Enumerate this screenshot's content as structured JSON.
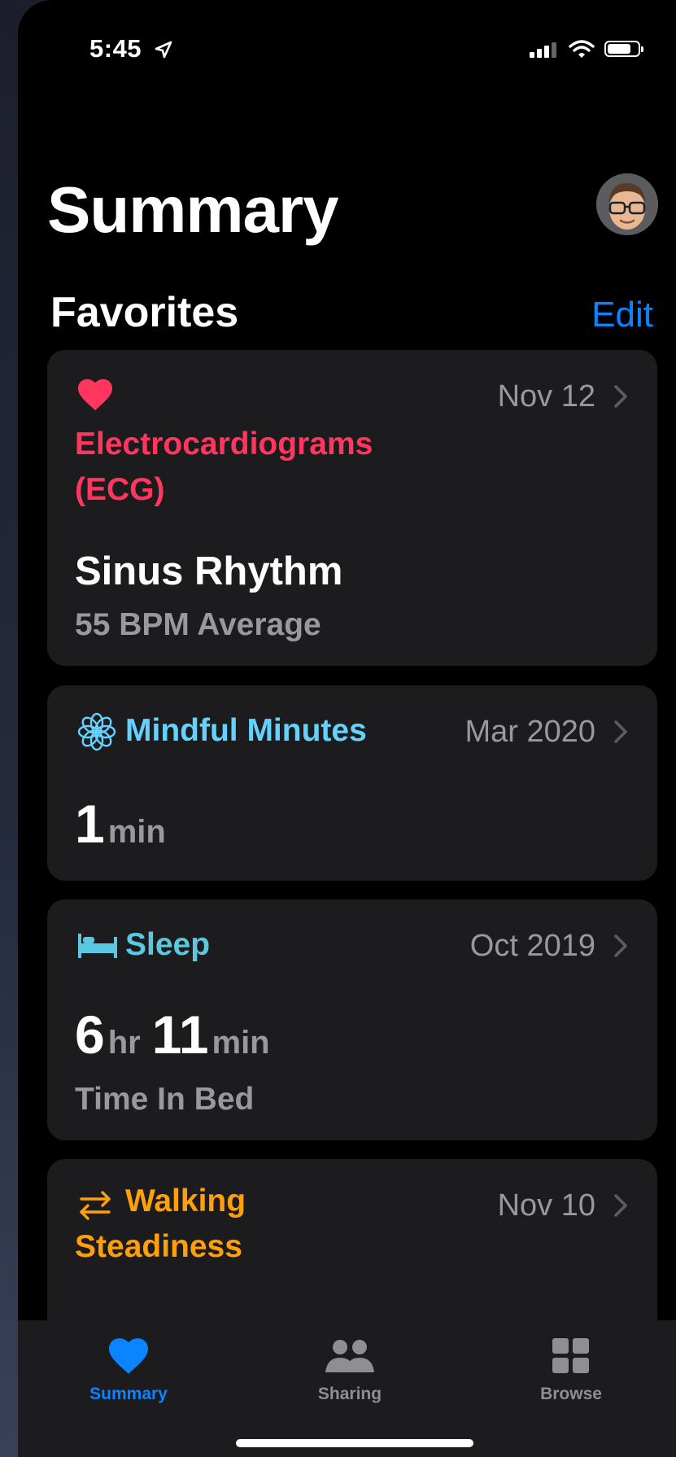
{
  "status_bar": {
    "time": "5:45"
  },
  "header": {
    "title": "Summary"
  },
  "favorites": {
    "title": "Favorites",
    "edit_label": "Edit"
  },
  "cards": [
    {
      "title_line1": "Electrocardiograms",
      "title_line2": "(ECG)",
      "date": "Nov 12",
      "value": "Sinus Rhythm",
      "subtitle": "55 BPM Average",
      "color": "#ff375f",
      "icon": "heart-icon"
    },
    {
      "title": "Mindful Minutes",
      "date": "Mar 2020",
      "value": "1",
      "unit": "min",
      "color": "#64d2ff",
      "icon": "mindfulness-icon"
    },
    {
      "title": "Sleep",
      "date": "Oct 2019",
      "hours": "6",
      "hours_unit": "hr",
      "minutes": "11",
      "minutes_unit": "min",
      "subtitle": "Time In Bed",
      "color": "#5ac8e0",
      "icon": "bed-icon"
    },
    {
      "title_line1": "Walking",
      "title_line2": "Steadiness",
      "date": "Nov 10",
      "color": "#ff9f0a",
      "icon": "arrows-icon"
    }
  ],
  "tabbar": {
    "tabs": [
      {
        "label": "Summary",
        "icon": "heart-icon",
        "active": true
      },
      {
        "label": "Sharing",
        "icon": "people-icon",
        "active": false
      },
      {
        "label": "Browse",
        "icon": "grid-icon",
        "active": false
      }
    ]
  },
  "colors": {
    "accent": "#0a84ff",
    "background": "#000000",
    "card": "#1c1c1e"
  }
}
